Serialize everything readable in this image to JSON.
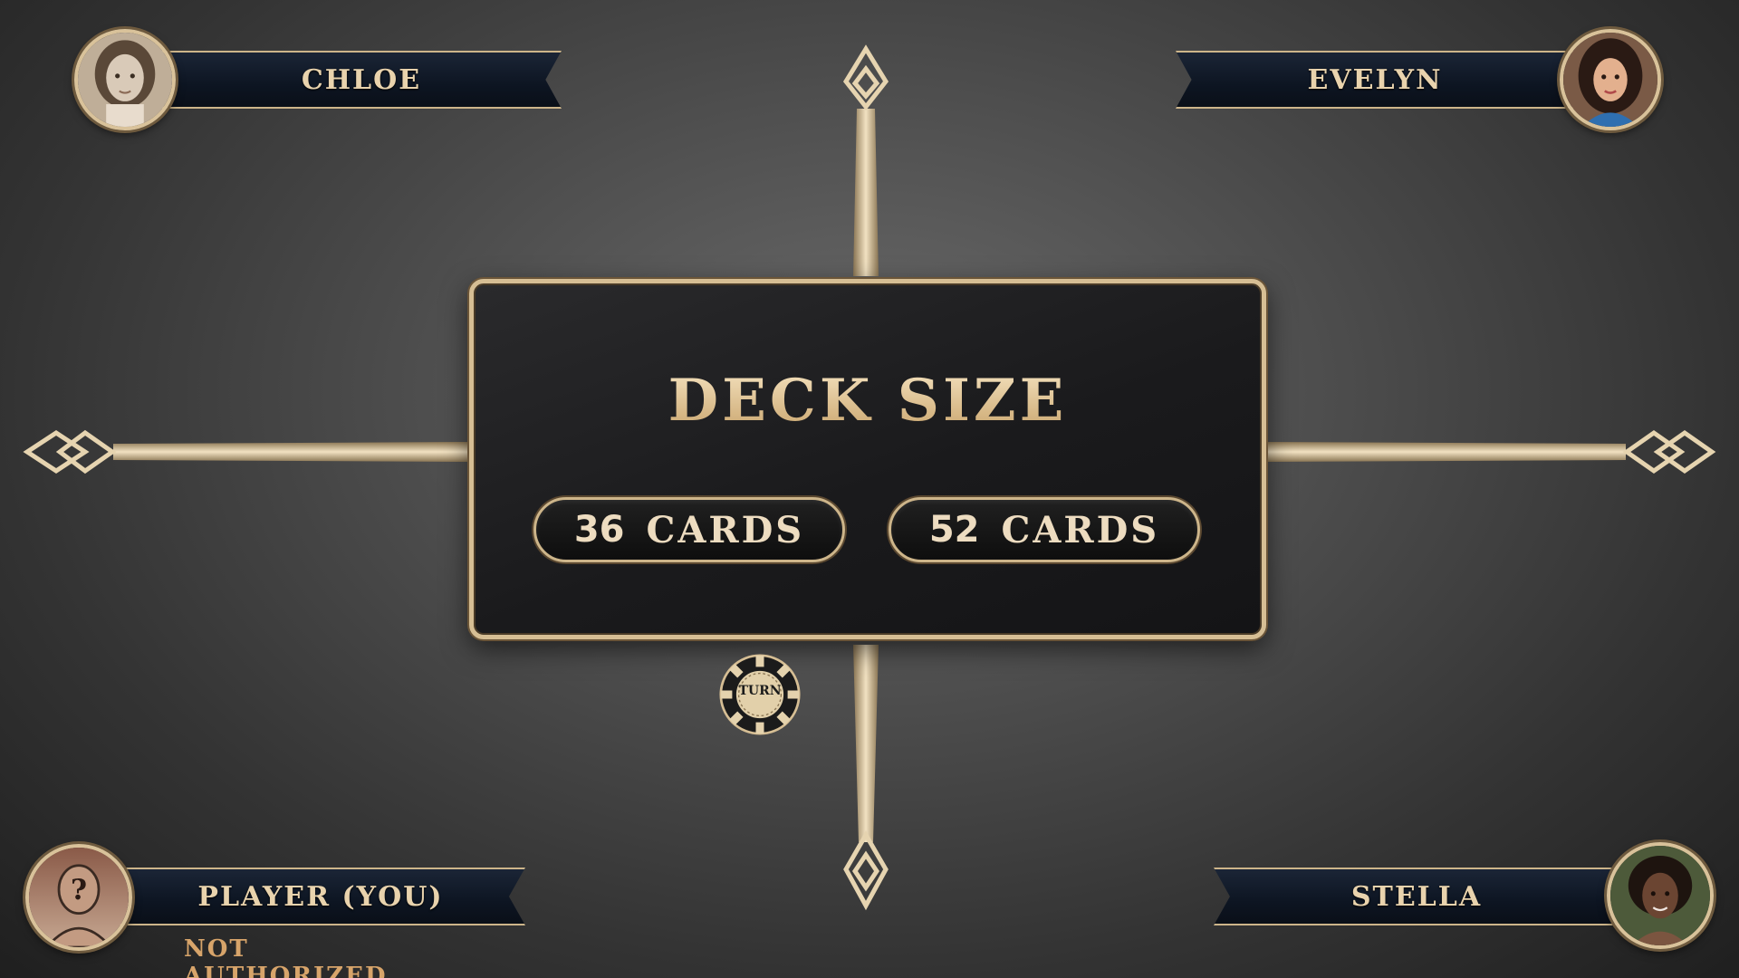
{
  "dialog": {
    "title": "DECK SIZE",
    "options": [
      {
        "count": "36",
        "unit": "CARDS"
      },
      {
        "count": "52",
        "unit": "CARDS"
      }
    ]
  },
  "players": {
    "top_left": {
      "name": "CHLOE",
      "avatar": "portrait-photo-sepia"
    },
    "top_right": {
      "name": "EVELYN",
      "avatar": "portrait-illustration"
    },
    "bottom_left": {
      "name": "PLAYER (YOU)",
      "status": "NOT AUTHORIZED",
      "avatar": "unknown-person-icon"
    },
    "bottom_right": {
      "name": "STELLA",
      "avatar": "portrait-photo"
    }
  },
  "turn_indicator": {
    "label": "TURN"
  },
  "colors": {
    "gold": "#d6be94",
    "banner_navy": "#0d1522",
    "status_orange": "#d7a46a"
  }
}
